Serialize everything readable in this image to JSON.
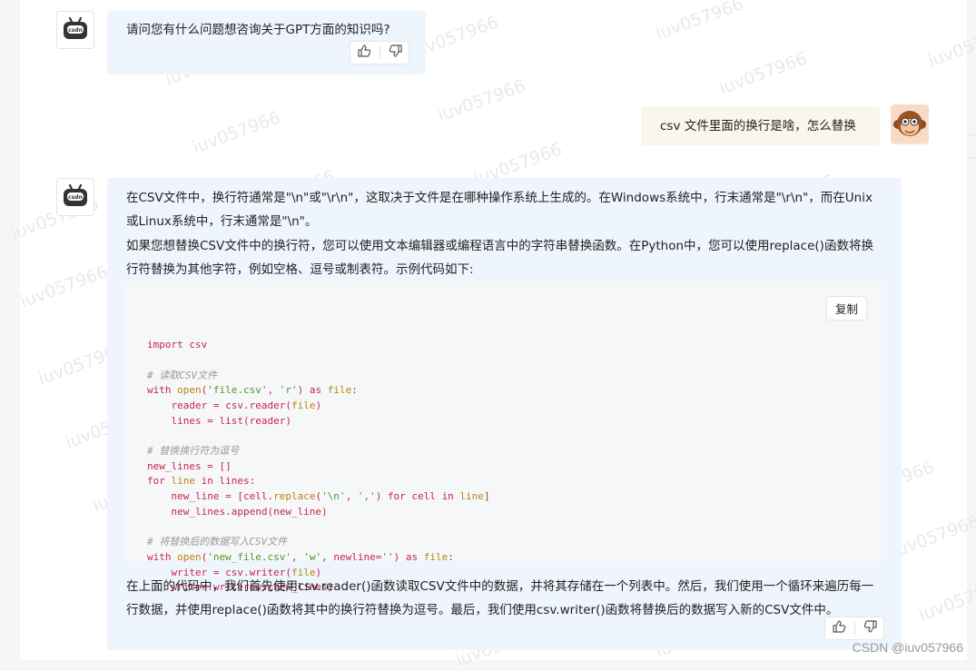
{
  "messages": [
    {
      "role": "bot",
      "text": "请问您有什么问题想咨询关于GPT方面的知识吗?"
    },
    {
      "role": "user",
      "text": "csv 文件里面的换行是啥，怎么替换"
    },
    {
      "role": "bot",
      "paragraphs": [
        "在CSV文件中，换行符通常是\"\\n\"或\"\\r\\n\"，这取决于文件是在哪种操作系统上生成的。在Windows系统中，行末通常是\"\\r\\n\"，而在Unix或Linux系统中，行末通常是\"\\n\"。",
        "如果您想替换CSV文件中的换行符，您可以使用文本编辑器或编程语言中的字符串替换函数。在Python中，您可以使用replace()函数将换行符替换为其他字符，例如空格、逗号或制表符。示例代码如下:"
      ],
      "code_lines": [
        "import csv",
        "",
        "# 读取CSV文件",
        "with open('file.csv', 'r') as file:",
        "    reader = csv.reader(file)",
        "    lines = list(reader)",
        "",
        "# 替换换行符为逗号",
        "new_lines = []",
        "for line in lines:",
        "    new_line = [cell.replace('\\n', ',') for cell in line]",
        "    new_lines.append(new_line)",
        "",
        "# 将替换后的数据写入CSV文件",
        "with open('new_file.csv', 'w', newline='') as file:",
        "    writer = csv.writer(file)",
        "    writer.writerows(new_lines)"
      ],
      "copy_label": "复制",
      "closing": "在上面的代码中，我们首先使用csv.reader()函数读取CSV文件中的数据，并将其存储在一个列表中。然后，我们使用一个循环来遍历每一行数据，并使用replace()函数将其中的换行符替换为逗号。最后，我们使用csv.writer()函数将替换后的数据写入新的CSV文件中。"
    }
  ],
  "watermark_text": "iuv057966",
  "footer_watermark": "CSDN @iuv057966",
  "bot_badge": "csdn",
  "colors": {
    "bot_bubble": "#eef5fd",
    "user_bubble": "#fbf6ec",
    "code_bg": "#f6f7f9",
    "code_text": "#c7254e",
    "code_keyword": "#c7254e",
    "code_string": "#4f9a28",
    "code_comment": "#999999"
  },
  "icons": [
    "robot-icon",
    "monkey-avatar-icon",
    "thumbs-up-icon",
    "thumbs-down-icon"
  ]
}
